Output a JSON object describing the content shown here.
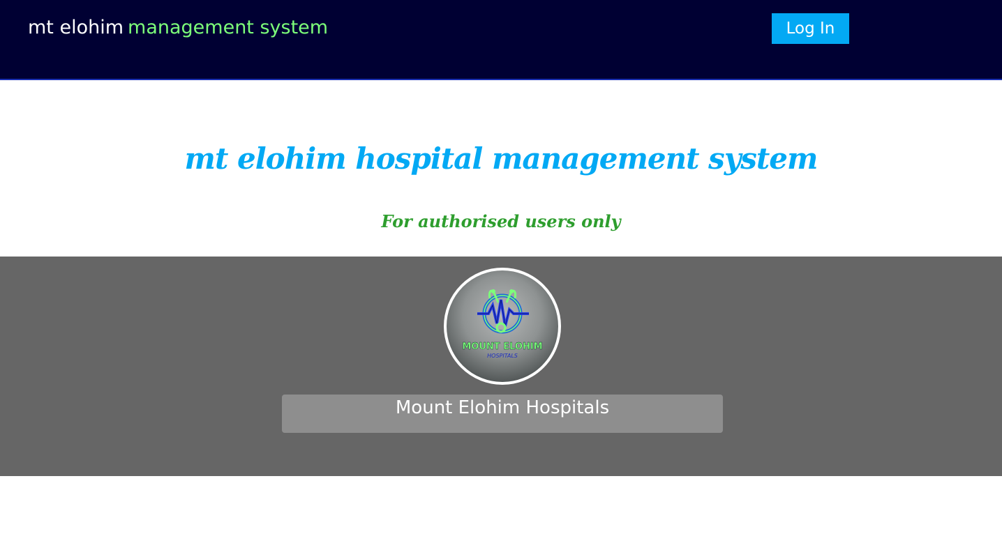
{
  "header": {
    "brand_part1": "mt elohim",
    "brand_part2": "management system",
    "login_label": "Log In"
  },
  "hero": {
    "title": "mt elohim hospital management system",
    "subtitle": "For authorised users only"
  },
  "profile": {
    "logo_text_line1": "MOUNT ELOHIM",
    "logo_text_line2": "HOSPITALS",
    "name": "Mount Elohim Hospitals"
  },
  "colors": {
    "header_bg": "#000033",
    "accent_blue": "#03a9f4",
    "brand_green": "#7dff7a",
    "subtitle_green": "#2e9e2e",
    "band_gray": "#666666"
  }
}
